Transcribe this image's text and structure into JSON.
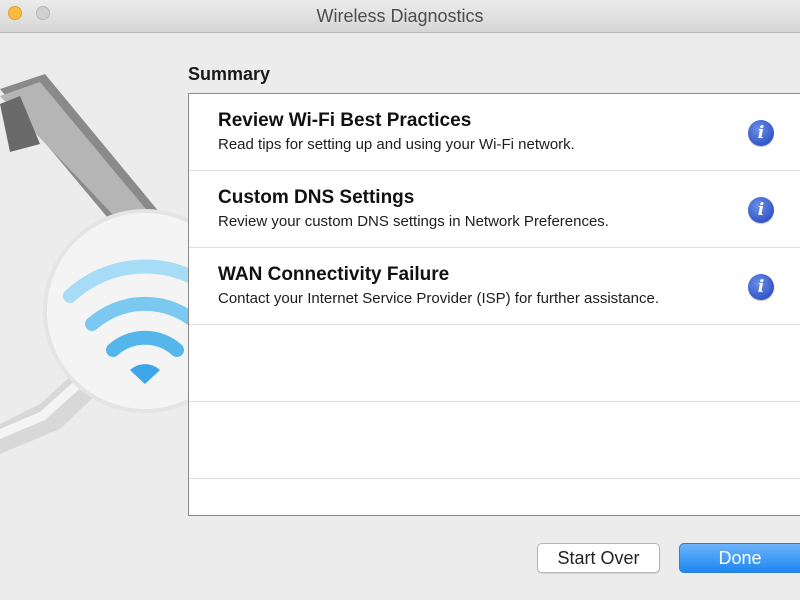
{
  "window": {
    "title": "Wireless Diagnostics"
  },
  "summary": {
    "label": "Summary",
    "items": [
      {
        "title": "Review Wi-Fi Best Practices",
        "description": "Read tips for setting up and using your Wi-Fi network.",
        "icon": "info-icon"
      },
      {
        "title": "Custom DNS Settings",
        "description": "Review your custom DNS settings in Network Preferences.",
        "icon": "info-icon"
      },
      {
        "title": "WAN Connectivity Failure",
        "description": "Contact your Internet Service Provider (ISP) for further assistance.",
        "icon": "info-icon"
      }
    ]
  },
  "buttons": {
    "start_over": "Start Over",
    "done": "Done"
  },
  "colors": {
    "accent": "#1c87f3",
    "info": "#3457c9",
    "close_button": "#fdbc40"
  }
}
